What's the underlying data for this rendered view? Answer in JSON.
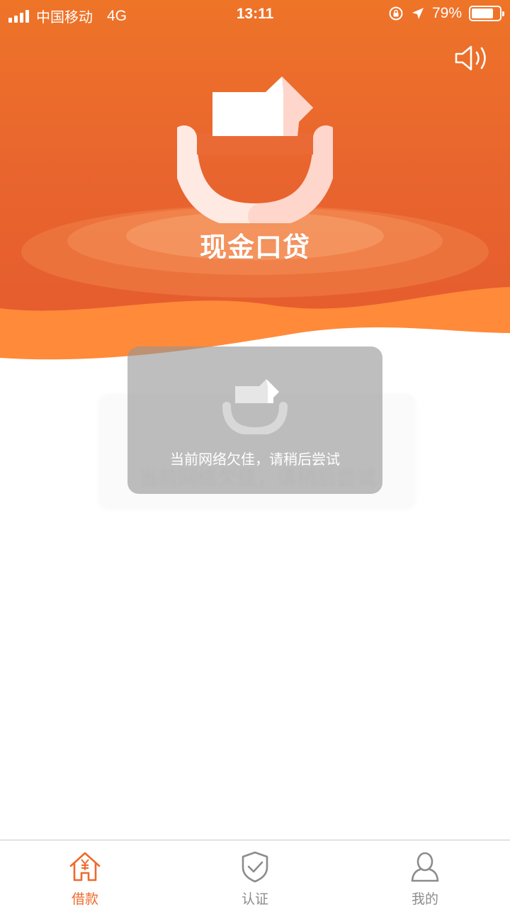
{
  "status_bar": {
    "carrier": "中国移动",
    "network": "4G",
    "time": "13:11",
    "battery": "79%",
    "battery_level": 0.79
  },
  "header": {
    "brand_name": "现金口贷",
    "sound_icon": "speaker-icon",
    "accent_color": "#ee7428"
  },
  "toast": {
    "message": "当前网络欠佳，请稍后尝试"
  },
  "tab_bar": {
    "active_color": "#ef6a2a",
    "inactive_color": "#8c8c8c",
    "tabs": [
      {
        "label": "借款",
        "icon": "house-yen-icon",
        "active": true
      },
      {
        "label": "认证",
        "icon": "shield-check-icon",
        "active": false
      },
      {
        "label": "我的",
        "icon": "person-icon",
        "active": false
      }
    ]
  }
}
